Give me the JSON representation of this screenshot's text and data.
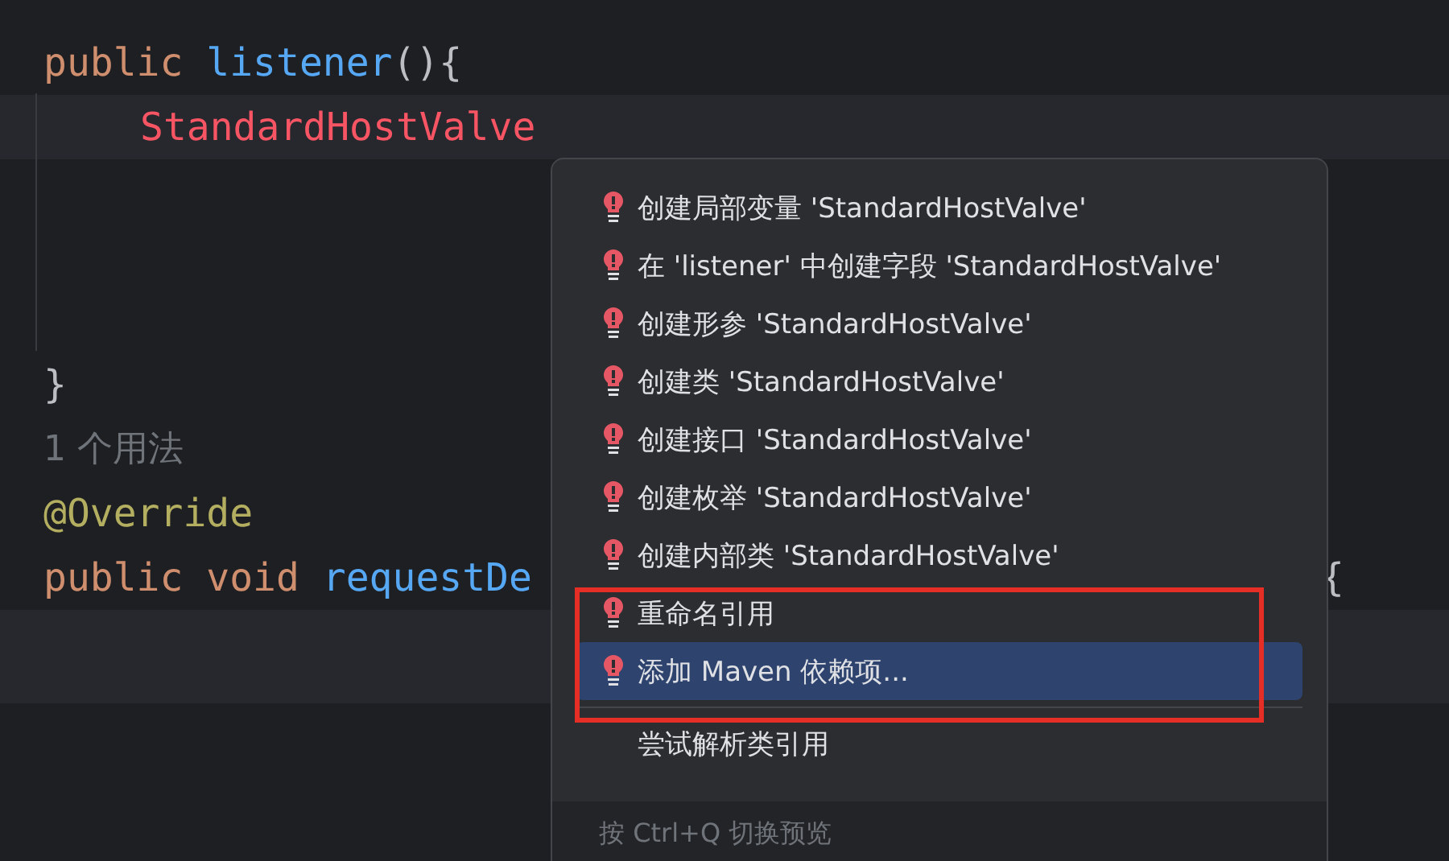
{
  "editor": {
    "lines": [
      {
        "current": false,
        "tokens": [
          {
            "kind": "keyword",
            "text": "public "
          },
          {
            "kind": "method",
            "text": "listener"
          },
          {
            "kind": "punct",
            "text": "(){"
          }
        ]
      },
      {
        "current": true,
        "indented": true,
        "tokens": [
          {
            "kind": "error",
            "text": "StandardHostValve"
          }
        ]
      },
      {
        "current": false
      },
      {
        "current": false
      },
      {
        "current": false
      },
      {
        "current": false,
        "tokens": [
          {
            "kind": "punct",
            "text": "}"
          }
        ]
      },
      {
        "current": false,
        "tokens": [
          {
            "kind": "hint",
            "text": "1 个用法"
          }
        ]
      },
      {
        "current": false,
        "tokens": [
          {
            "kind": "annotation",
            "text": "@Override"
          }
        ]
      },
      {
        "current": false,
        "tokens": [
          {
            "kind": "keyword",
            "text": "public void "
          },
          {
            "kind": "method",
            "text": "requestDe"
          }
        ],
        "tail": "{"
      },
      {
        "current": true
      }
    ]
  },
  "popup": {
    "items": [
      {
        "label": "创建局部变量 'StandardHostValve'",
        "icon": true,
        "selected": false
      },
      {
        "label": "在 'listener' 中创建字段 'StandardHostValve'",
        "icon": true,
        "selected": false
      },
      {
        "label": "创建形参 'StandardHostValve'",
        "icon": true,
        "selected": false
      },
      {
        "label": "创建类 'StandardHostValve'",
        "icon": true,
        "selected": false
      },
      {
        "label": "创建接口 'StandardHostValve'",
        "icon": true,
        "selected": false
      },
      {
        "label": "创建枚举 'StandardHostValve'",
        "icon": true,
        "selected": false
      },
      {
        "label": "创建内部类 'StandardHostValve'",
        "icon": true,
        "selected": false
      },
      {
        "label": "重命名引用",
        "icon": true,
        "selected": false
      },
      {
        "label": "添加 Maven 依赖项...",
        "icon": true,
        "selected": true
      }
    ],
    "extra_items": [
      {
        "label": "尝试解析类引用",
        "icon": false,
        "selected": false
      }
    ],
    "footer": "按 Ctrl+Q 切换预览"
  }
}
